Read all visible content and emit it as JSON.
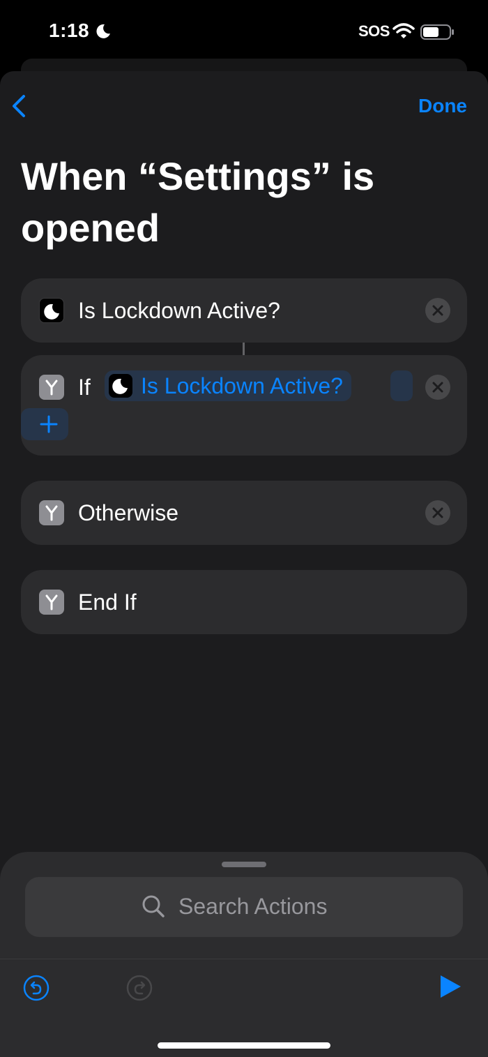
{
  "status_bar": {
    "time": "1:18",
    "carrier": "SOS",
    "icons": [
      "moon-icon",
      "wifi-icon",
      "battery-icon"
    ]
  },
  "nav": {
    "back_icon": "chevron-left-icon",
    "done_label": "Done"
  },
  "title": "When “Settings” is opened",
  "actions": [
    {
      "icon": "moon-icon",
      "label": "Is Lockdown Active?"
    },
    {
      "icon": "branch-icon",
      "label": "If",
      "variable": "Is Lockdown Active?",
      "variable_icon": "moon-icon"
    },
    {
      "icon": "branch-icon",
      "label": "Otherwise"
    },
    {
      "icon": "branch-icon",
      "label": "End If"
    }
  ],
  "search": {
    "placeholder": "Search Actions",
    "icon": "magnifying-glass-icon"
  },
  "toolbar": {
    "undo_icon": "undo-icon",
    "redo_icon": "redo-icon",
    "run_icon": "play-icon"
  },
  "colors": {
    "accent": "#0a84ff",
    "sheet_bg": "#1c1c1e",
    "card_bg": "#2c2c2e"
  }
}
